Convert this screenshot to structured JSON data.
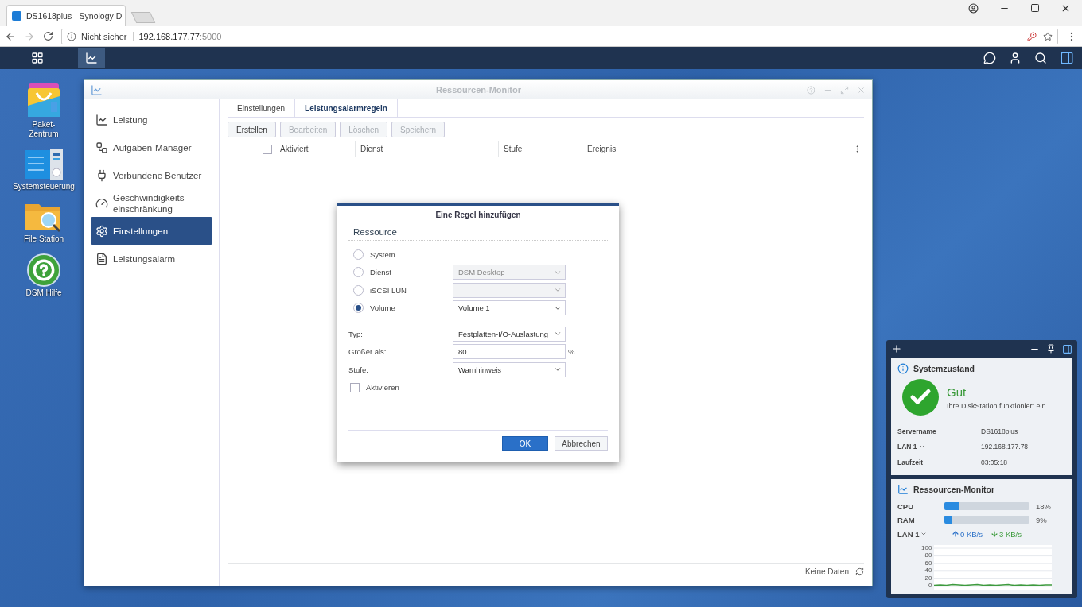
{
  "browser": {
    "tab_title": "DS1618plus - Synology D",
    "security": "Nicht sicher",
    "url_host": "192.168.177.77",
    "url_port": ":5000"
  },
  "desktop_icons": [
    {
      "kind": "package",
      "label": "Paket-\nZentrum"
    },
    {
      "kind": "control",
      "label": "Systemsteuerung"
    },
    {
      "kind": "folder",
      "label": "File Station"
    },
    {
      "kind": "help",
      "label": "DSM Hilfe"
    }
  ],
  "window": {
    "title": "Ressourcen-Monitor",
    "sidebar": [
      {
        "kind": "chart",
        "label": "Leistung",
        "selected": false
      },
      {
        "kind": "tasks",
        "label": "Aufgaben-Manager",
        "selected": false
      },
      {
        "kind": "plug",
        "label": "Verbundene Benutzer",
        "selected": false
      },
      {
        "kind": "gauge",
        "label": "Geschwindigkeits-\neinschränkung",
        "selected": false
      },
      {
        "kind": "gear",
        "label": "Einstellungen",
        "selected": true
      },
      {
        "kind": "list",
        "label": "Leistungsalarm",
        "selected": false
      }
    ],
    "tabs": [
      {
        "label": "Einstellungen",
        "selected": false
      },
      {
        "label": "Leistungsalarmregeln",
        "selected": true
      }
    ],
    "toolbar": [
      {
        "label": "Erstellen",
        "disabled": false
      },
      {
        "label": "Bearbeiten",
        "disabled": true
      },
      {
        "label": "Löschen",
        "disabled": true
      },
      {
        "label": "Speichern",
        "disabled": true
      }
    ],
    "header_checked": false,
    "columns": [
      "Aktiviert",
      "Dienst",
      "Stufe",
      "Ereignis"
    ],
    "footer": "Keine Daten"
  },
  "dialog": {
    "title": "Eine Regel hinzufügen",
    "section": "Ressource",
    "options": [
      {
        "label": "System",
        "selected": false
      },
      {
        "label": "Dienst",
        "selected": false,
        "dropdown": {
          "value": "DSM Desktop",
          "disabled": true
        }
      },
      {
        "label": "iSCSI LUN",
        "selected": false,
        "dropdown": {
          "disabled": true
        }
      },
      {
        "label": "Volume",
        "selected": true,
        "dropdown": {
          "value": "Volume 1",
          "disabled": false
        }
      }
    ],
    "type_label": "Typ:",
    "type_value": "Festplatten-I/O-Auslastung",
    "threshold_label": "Größer als:",
    "threshold_value": "80",
    "threshold_unit": "%",
    "level_label": "Stufe:",
    "level_value": "Warnhinweis",
    "enable": {
      "label": "Aktivieren",
      "checked": false
    },
    "ok": "OK",
    "cancel": "Abbrechen"
  },
  "system_status": {
    "title": "Systemzustand",
    "status": "Gut",
    "message": "Ihre DiskStation funktioniert ein…",
    "rows": [
      {
        "label": "Servername",
        "value": "DS1618plus"
      },
      {
        "label": "LAN 1",
        "value": "192.168.177.78",
        "dropdown": true
      },
      {
        "label": "Laufzeit",
        "value": "03:05:18"
      }
    ]
  },
  "resource_monitor": {
    "title": "Ressourcen-Monitor",
    "meters": [
      {
        "label": "CPU",
        "level": 0.18,
        "reading": "18%"
      },
      {
        "label": "RAM",
        "level": 0.09,
        "reading": "9%"
      }
    ],
    "lan": "LAN 1",
    "upload": "0 KB/s",
    "download": "3 KB/s",
    "chart_data": {
      "type": "line",
      "ylim": [
        0,
        100
      ],
      "yticks": [
        0,
        20,
        40,
        60,
        80,
        100
      ],
      "grid": true,
      "series": [
        {
          "color": "#3e9a3e",
          "values": [
            3,
            4,
            3,
            5,
            4,
            3,
            4,
            5,
            3,
            4,
            3,
            4,
            5,
            3,
            4,
            3,
            4,
            3,
            4,
            4
          ]
        }
      ]
    }
  }
}
